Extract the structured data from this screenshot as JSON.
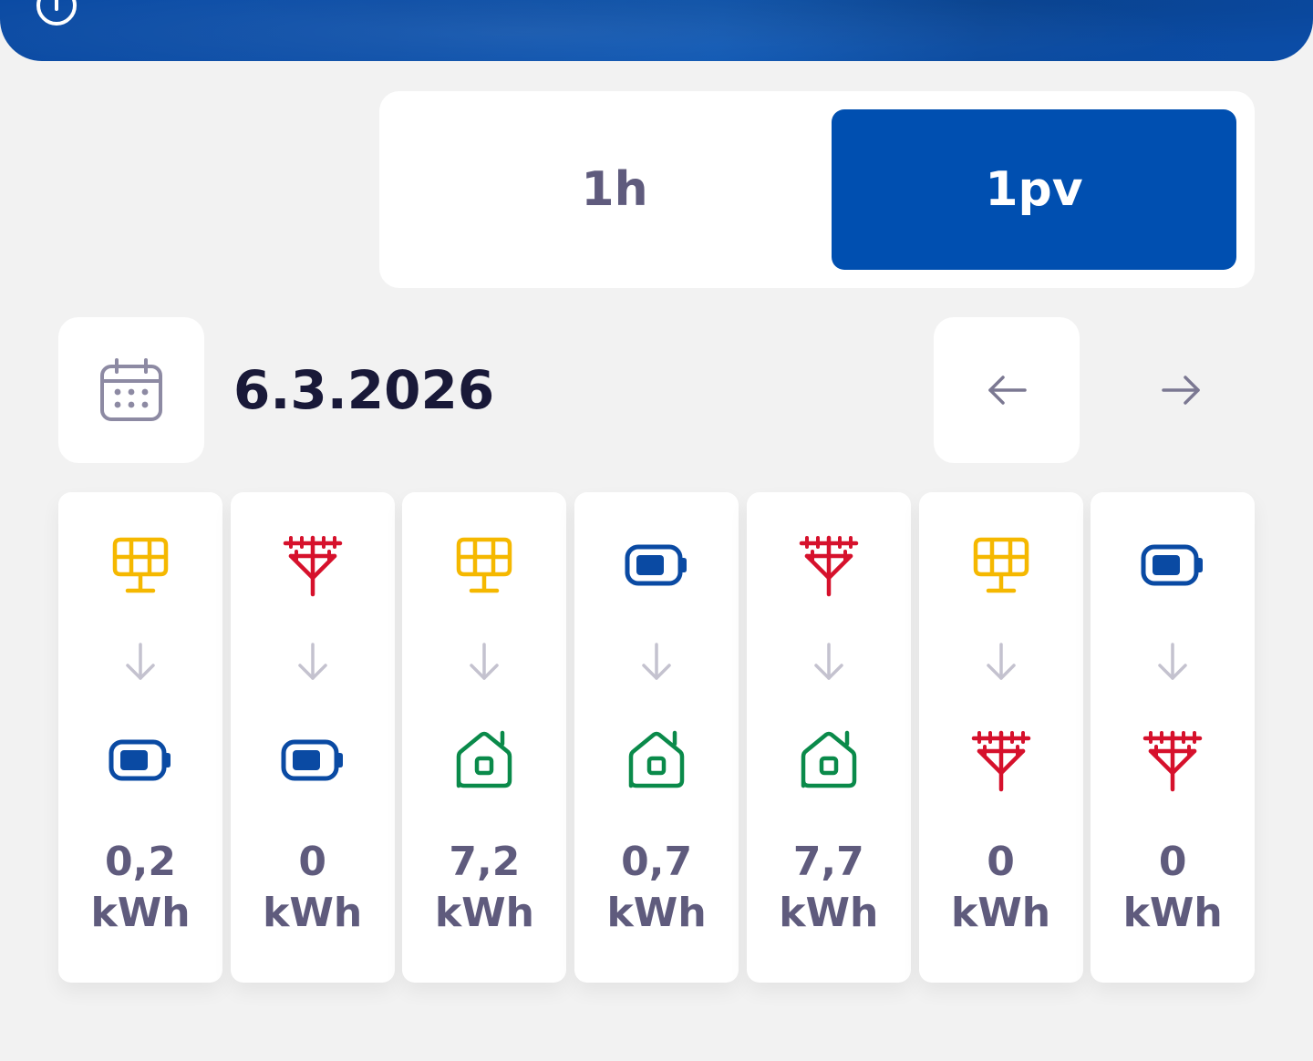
{
  "colors": {
    "brand_blue": "#004fb0",
    "solar_yellow": "#f5b800",
    "grid_red": "#d6112c",
    "battery_blue": "#0a4aa3",
    "home_green": "#0a8a4a",
    "text_dark": "#191938",
    "text_muted": "#5f5b7d",
    "background": "#f2f2f2"
  },
  "header": {
    "info_icon": "info-icon"
  },
  "period_toggle": {
    "options": [
      {
        "label": "1h",
        "active": false
      },
      {
        "label": "1pv",
        "active": true
      }
    ]
  },
  "date_nav": {
    "calendar_icon": "calendar-icon",
    "date": "6.3.2026",
    "prev_icon": "arrow-left-icon",
    "next_icon": "arrow-right-icon"
  },
  "flows": [
    {
      "from": "solar-panel-icon",
      "to": "battery-icon",
      "value": "0,2",
      "unit": "kWh"
    },
    {
      "from": "power-grid-icon",
      "to": "battery-icon",
      "value": "0",
      "unit": "kWh"
    },
    {
      "from": "solar-panel-icon",
      "to": "home-icon",
      "value": "7,2",
      "unit": "kWh"
    },
    {
      "from": "battery-icon",
      "to": "home-icon",
      "value": "0,7",
      "unit": "kWh"
    },
    {
      "from": "power-grid-icon",
      "to": "home-icon",
      "value": "7,7",
      "unit": "kWh"
    },
    {
      "from": "solar-panel-icon",
      "to": "power-grid-icon",
      "value": "0",
      "unit": "kWh"
    },
    {
      "from": "battery-icon",
      "to": "power-grid-icon",
      "value": "0",
      "unit": "kWh"
    }
  ]
}
